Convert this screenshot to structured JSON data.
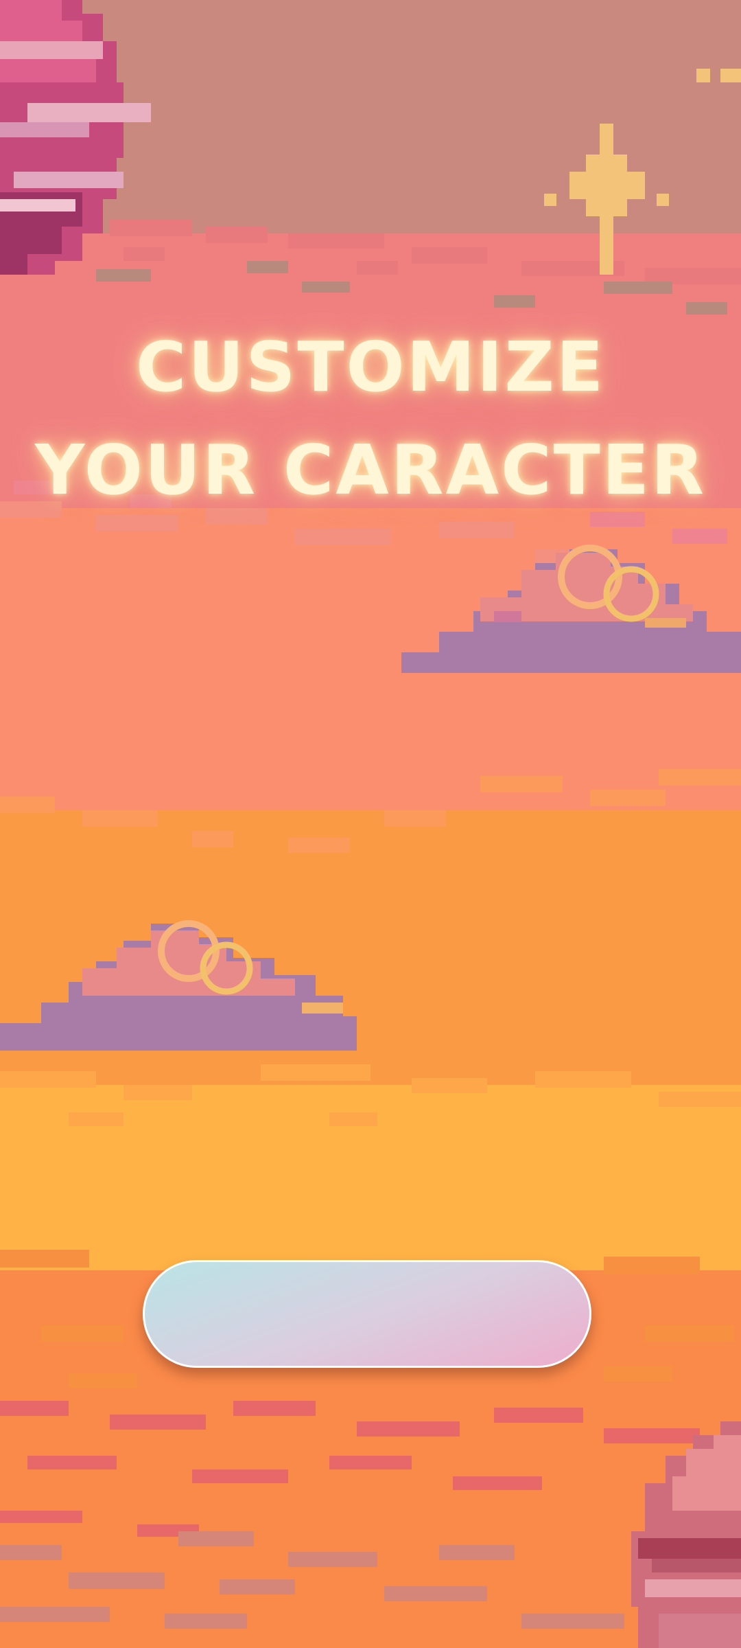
{
  "screen": {
    "title_line_1": "CUSTOMIZE",
    "title_line_2": "YOUR CARACTER"
  },
  "scene": {
    "objects": [
      "planet",
      "sparkle",
      "cloud",
      "cloud",
      "planet"
    ]
  },
  "colors": {
    "sky_top": "#c9897e",
    "band_pink": "#f08080",
    "band_coral": "#fa8e6e",
    "band_orange": "#fb9a45",
    "band_yellow": "#ffb347",
    "band_bottom": "#fa8a4a",
    "title_text": "#fff6d8",
    "button_gradient_start": "#b9e4e6",
    "button_gradient_end": "#eeadcc"
  }
}
